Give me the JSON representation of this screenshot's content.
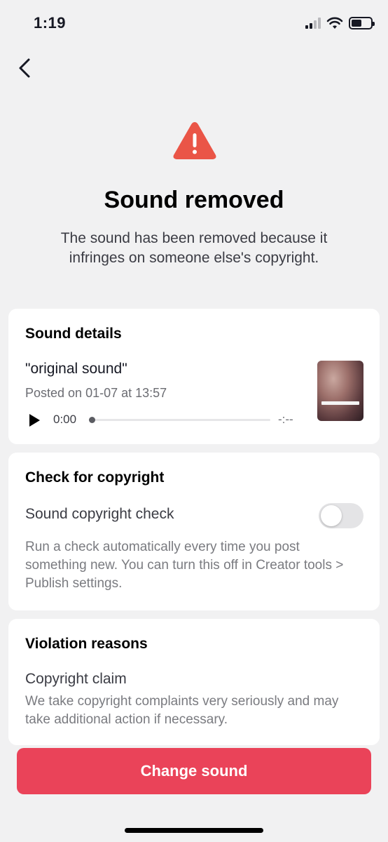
{
  "status_bar": {
    "time": "1:19"
  },
  "header": {
    "title": "Sound removed",
    "message": "The sound has been removed because it infringes on someone else's copyright."
  },
  "sound_details": {
    "heading": "Sound details",
    "name": "\"original sound\"",
    "posted": "Posted on 01-07 at 13:57",
    "current_time": "0:00",
    "duration": "-:--",
    "progress": 0
  },
  "copyright_check": {
    "heading": "Check for copyright",
    "label": "Sound copyright check",
    "enabled": false,
    "description": "Run a check automatically every time you post something new. You can turn this off in Creator tools > Publish settings."
  },
  "violation": {
    "heading": "Violation reasons",
    "reason": "Copyright claim",
    "description": "We take copyright complaints very seriously and may take additional action if necessary."
  },
  "actions": {
    "change_sound": "Change sound"
  },
  "colors": {
    "accent": "#ea4359",
    "warning": "#ea5547",
    "background": "#f1f1f2"
  }
}
